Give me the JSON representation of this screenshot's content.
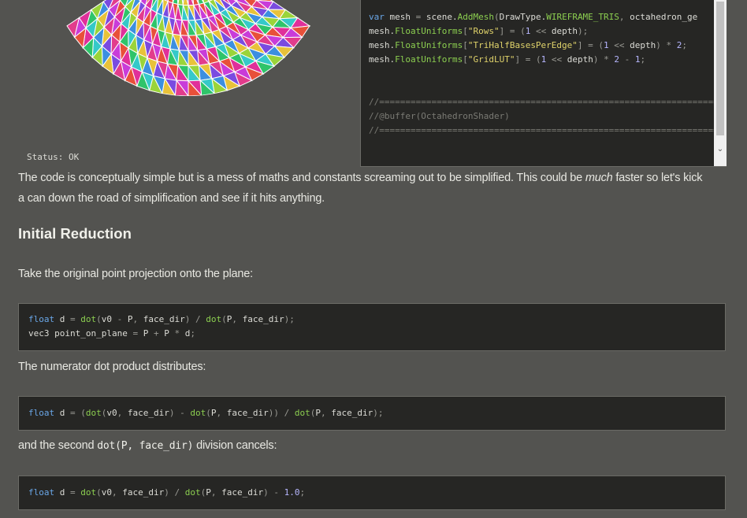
{
  "status": {
    "label": "Status:",
    "value": "OK"
  },
  "editor": {
    "lines": [
      [
        [
          "kw",
          "var"
        ],
        [
          "tx",
          " mesh "
        ],
        [
          "pun",
          "="
        ],
        [
          "tx",
          " scene."
        ],
        [
          "fn",
          "AddMesh"
        ],
        [
          "pun",
          "("
        ],
        [
          "tx",
          "DrawType."
        ],
        [
          "fn",
          "WIREFRAME_TRIS"
        ],
        [
          "pun",
          ","
        ],
        [
          "tx",
          " octahedron_ge"
        ]
      ],
      [
        [
          "tx",
          "mesh."
        ],
        [
          "fn",
          "FloatUniforms"
        ],
        [
          "pun",
          "["
        ],
        [
          "str",
          "\"Rows\""
        ],
        [
          "pun",
          "]"
        ],
        [
          "tx",
          " "
        ],
        [
          "pun",
          "="
        ],
        [
          "tx",
          " "
        ],
        [
          "pun",
          "("
        ],
        [
          "num",
          "1"
        ],
        [
          "tx",
          " "
        ],
        [
          "pun",
          "<<"
        ],
        [
          "tx",
          " depth"
        ],
        [
          "pun",
          ");"
        ]
      ],
      [
        [
          "tx",
          "mesh."
        ],
        [
          "fn",
          "FloatUniforms"
        ],
        [
          "pun",
          "["
        ],
        [
          "str",
          "\"TriHalfBasesPerEdge\""
        ],
        [
          "pun",
          "]"
        ],
        [
          "tx",
          " "
        ],
        [
          "pun",
          "="
        ],
        [
          "tx",
          " "
        ],
        [
          "pun",
          "("
        ],
        [
          "num",
          "1"
        ],
        [
          "tx",
          " "
        ],
        [
          "pun",
          "<<"
        ],
        [
          "tx",
          " depth"
        ],
        [
          "pun",
          ")"
        ],
        [
          "tx",
          " "
        ],
        [
          "pun",
          "*"
        ],
        [
          "tx",
          " "
        ],
        [
          "num",
          "2"
        ],
        [
          "pun",
          ";"
        ]
      ],
      [
        [
          "tx",
          "mesh."
        ],
        [
          "fn",
          "FloatUniforms"
        ],
        [
          "pun",
          "["
        ],
        [
          "str",
          "\"GridLUT\""
        ],
        [
          "pun",
          "]"
        ],
        [
          "tx",
          " "
        ],
        [
          "pun",
          "="
        ],
        [
          "tx",
          " "
        ],
        [
          "pun",
          "("
        ],
        [
          "num",
          "1"
        ],
        [
          "tx",
          " "
        ],
        [
          "pun",
          "<<"
        ],
        [
          "tx",
          " depth"
        ],
        [
          "pun",
          ")"
        ],
        [
          "tx",
          " "
        ],
        [
          "pun",
          "*"
        ],
        [
          "tx",
          " "
        ],
        [
          "num",
          "2"
        ],
        [
          "tx",
          " "
        ],
        [
          "pun",
          "-"
        ],
        [
          "tx",
          " "
        ],
        [
          "num",
          "1"
        ],
        [
          "pun",
          ";"
        ]
      ],
      [],
      [],
      [
        [
          "cm",
          "//========================================================================"
        ]
      ],
      [
        [
          "cm",
          "//@buffer(OctahedronShader)"
        ]
      ],
      [
        [
          "cm",
          "//========================================================================"
        ]
      ]
    ]
  },
  "article": {
    "para1_a": "The code is conceptually simple but is a mess of maths and constants screaming out to be simplified. This could be ",
    "para1_em": "much",
    "para1_b": " faster so let's kick",
    "para1_line2": "a can down the road of simplification and see if it hits anything.",
    "heading": "Initial Reduction",
    "para2": "Take the original point projection onto the plane:",
    "para3": "The numerator dot product distributes:",
    "para4_a": "and the second",
    "para4_code": "dot(P, face_dir)",
    "para4_b": "division cancels:"
  },
  "code_blocks": [
    [
      [
        [
          "kw",
          "float"
        ],
        [
          "tx",
          " d "
        ],
        [
          "pun",
          "="
        ],
        [
          "tx",
          " "
        ],
        [
          "fn",
          "dot"
        ],
        [
          "pun",
          "("
        ],
        [
          "tx",
          "v0 "
        ],
        [
          "pun",
          "-"
        ],
        [
          "tx",
          " P"
        ],
        [
          "pun",
          ","
        ],
        [
          "tx",
          " face_dir"
        ],
        [
          "pun",
          ")"
        ],
        [
          "tx",
          " "
        ],
        [
          "pun",
          "/"
        ],
        [
          "tx",
          " "
        ],
        [
          "fn",
          "dot"
        ],
        [
          "pun",
          "("
        ],
        [
          "tx",
          "P"
        ],
        [
          "pun",
          ","
        ],
        [
          "tx",
          " face_dir"
        ],
        [
          "pun",
          ");"
        ]
      ],
      [
        [
          "tx",
          "vec3 point_on_plane "
        ],
        [
          "pun",
          "="
        ],
        [
          "tx",
          " P "
        ],
        [
          "pun",
          "+"
        ],
        [
          "tx",
          " P "
        ],
        [
          "pun",
          "*"
        ],
        [
          "tx",
          " d"
        ],
        [
          "pun",
          ";"
        ]
      ]
    ],
    [
      [
        [
          "kw",
          "float"
        ],
        [
          "tx",
          " d "
        ],
        [
          "pun",
          "="
        ],
        [
          "tx",
          " "
        ],
        [
          "pun",
          "("
        ],
        [
          "fn",
          "dot"
        ],
        [
          "pun",
          "("
        ],
        [
          "tx",
          "v0"
        ],
        [
          "pun",
          ","
        ],
        [
          "tx",
          " face_dir"
        ],
        [
          "pun",
          ")"
        ],
        [
          "tx",
          " "
        ],
        [
          "pun",
          "-"
        ],
        [
          "tx",
          " "
        ],
        [
          "fn",
          "dot"
        ],
        [
          "pun",
          "("
        ],
        [
          "tx",
          "P"
        ],
        [
          "pun",
          ","
        ],
        [
          "tx",
          " face_dir"
        ],
        [
          "pun",
          "))"
        ],
        [
          "tx",
          " "
        ],
        [
          "pun",
          "/"
        ],
        [
          "tx",
          " "
        ],
        [
          "fn",
          "dot"
        ],
        [
          "pun",
          "("
        ],
        [
          "tx",
          "P"
        ],
        [
          "pun",
          ","
        ],
        [
          "tx",
          " face_dir"
        ],
        [
          "pun",
          ");"
        ]
      ]
    ],
    [
      [
        [
          "kw",
          "float"
        ],
        [
          "tx",
          " d "
        ],
        [
          "pun",
          "="
        ],
        [
          "tx",
          " "
        ],
        [
          "fn",
          "dot"
        ],
        [
          "pun",
          "("
        ],
        [
          "tx",
          "v0"
        ],
        [
          "pun",
          ","
        ],
        [
          "tx",
          " face_dir"
        ],
        [
          "pun",
          ")"
        ],
        [
          "tx",
          " "
        ],
        [
          "pun",
          "/"
        ],
        [
          "tx",
          " "
        ],
        [
          "fn",
          "dot"
        ],
        [
          "pun",
          "("
        ],
        [
          "tx",
          "P"
        ],
        [
          "pun",
          ","
        ],
        [
          "tx",
          " face_dir"
        ],
        [
          "pun",
          ")"
        ],
        [
          "tx",
          " "
        ],
        [
          "pun",
          "-"
        ],
        [
          "tx",
          " "
        ],
        [
          "num",
          "1.0"
        ],
        [
          "pun",
          ";"
        ]
      ]
    ]
  ],
  "colors": {
    "background": "#535350",
    "code_bg": "#262624",
    "keyword": "#6aa7e8",
    "function": "#8ccf50",
    "string": "#dfd26a",
    "number": "#b7b7ff"
  }
}
